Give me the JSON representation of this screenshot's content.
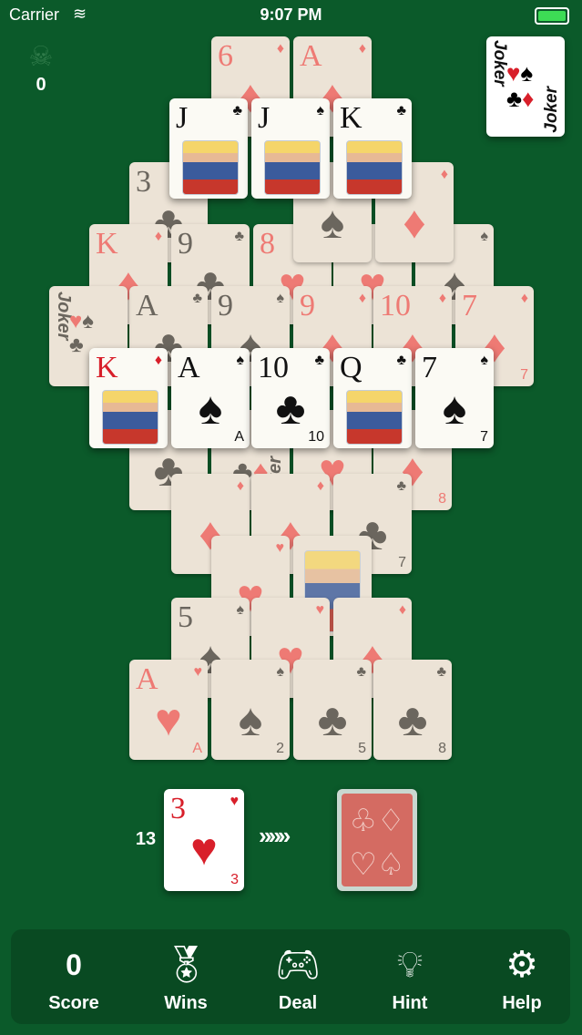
{
  "status_bar": {
    "carrier": "Carrier",
    "time": "9:07 PM"
  },
  "skull_counter": "0",
  "joker_card": {
    "text": "Joker"
  },
  "tableau": [
    {
      "id": "c1",
      "rank": "6",
      "suit": "♦",
      "color": "red",
      "dim": true,
      "pip": "6"
    },
    {
      "id": "c2",
      "rank": "A",
      "suit": "♦",
      "color": "red",
      "dim": true,
      "pip": "A"
    },
    {
      "id": "c3",
      "rank": "3",
      "suit": "♣",
      "color": "black",
      "dim": true,
      "pip": "3"
    },
    {
      "id": "c5",
      "rank": "K",
      "suit": "♦",
      "color": "red",
      "dim": true,
      "pip": "K"
    },
    {
      "id": "c6",
      "rank": "9",
      "suit": "♣",
      "color": "black",
      "dim": true,
      "pip": "9"
    },
    {
      "id": "c7",
      "rank": "8",
      "suit": "♥",
      "color": "red",
      "dim": true,
      "pip": "8"
    },
    {
      "id": "c8",
      "rank": "7",
      "suit": "♥",
      "color": "red",
      "dim": true,
      "pip": "7"
    },
    {
      "id": "c9",
      "rank": "6",
      "suit": "♠",
      "color": "black",
      "dim": true,
      "pip": "6"
    },
    {
      "id": "c10",
      "rank": "",
      "suit": "♠",
      "color": "black",
      "dim": true,
      "pip": ""
    },
    {
      "id": "c11",
      "rank": "",
      "suit": "♦",
      "color": "red",
      "dim": true,
      "pip": ""
    },
    {
      "id": "c13",
      "rank": "A",
      "suit": "♣",
      "color": "black",
      "dim": true,
      "pip": "A"
    },
    {
      "id": "c14",
      "rank": "9",
      "suit": "♠",
      "color": "black",
      "dim": true,
      "pip": "9"
    },
    {
      "id": "c15",
      "rank": "9",
      "suit": "♦",
      "color": "red",
      "dim": true,
      "pip": "9"
    },
    {
      "id": "c16",
      "rank": "10",
      "suit": "♦",
      "color": "red",
      "dim": true,
      "pip": "10"
    },
    {
      "id": "c17",
      "rank": "7",
      "suit": "♦",
      "color": "red",
      "dim": true,
      "pip": "7"
    },
    {
      "id": "c18",
      "rank": "",
      "suit": "♣",
      "color": "black",
      "dim": true,
      "pip": "6"
    },
    {
      "id": "c20",
      "rank": "",
      "suit": "♥",
      "color": "red",
      "dim": true,
      "pip": "9"
    },
    {
      "id": "c21",
      "rank": "",
      "suit": "♦",
      "color": "red",
      "dim": true,
      "pip": "8"
    },
    {
      "id": "c22",
      "rank": "",
      "suit": "♦",
      "color": "red",
      "dim": true,
      "pip": "4"
    },
    {
      "id": "c23",
      "rank": "",
      "suit": "♦",
      "color": "red",
      "dim": true,
      "pip": "3"
    },
    {
      "id": "c24",
      "rank": "",
      "suit": "♣",
      "color": "black",
      "dim": true,
      "pip": "7"
    },
    {
      "id": "c25",
      "rank": "",
      "suit": "♥",
      "color": "red",
      "dim": true,
      "pip": "5"
    },
    {
      "id": "c27",
      "rank": "5",
      "suit": "♠",
      "color": "black",
      "dim": true,
      "pip": "5"
    },
    {
      "id": "c28",
      "rank": "",
      "suit": "♥",
      "color": "red",
      "dim": true,
      "pip": "6"
    },
    {
      "id": "c29",
      "rank": "",
      "suit": "♦",
      "color": "red",
      "dim": true,
      "pip": "5"
    },
    {
      "id": "c30",
      "rank": "A",
      "suit": "♥",
      "color": "red",
      "dim": true,
      "pip": "A"
    },
    {
      "id": "c31",
      "rank": "",
      "suit": "♠",
      "color": "black",
      "dim": true,
      "pip": "2"
    },
    {
      "id": "c32",
      "rank": "",
      "suit": "♣",
      "color": "black",
      "dim": true,
      "pip": "5"
    },
    {
      "id": "c33",
      "rank": "",
      "suit": "♣",
      "color": "black",
      "dim": true,
      "pip": "8"
    },
    {
      "id": "c40",
      "rank": "J",
      "suit": "♣",
      "color": "black",
      "dim": false,
      "pip": "",
      "face": true
    },
    {
      "id": "c41",
      "rank": "J",
      "suit": "♠",
      "color": "black",
      "dim": false,
      "pip": "",
      "face": true
    },
    {
      "id": "c42",
      "rank": "K",
      "suit": "♣",
      "color": "black",
      "dim": false,
      "pip": "",
      "face": true
    },
    {
      "id": "c43",
      "rank": "K",
      "suit": "♦",
      "color": "red",
      "dim": false,
      "pip": "",
      "face": true
    },
    {
      "id": "c44",
      "rank": "A",
      "suit": "♠",
      "color": "black",
      "dim": false,
      "pip": "A"
    },
    {
      "id": "c45",
      "rank": "10",
      "suit": "♣",
      "color": "black",
      "dim": false,
      "pip": "10"
    },
    {
      "id": "c46",
      "rank": "Q",
      "suit": "♣",
      "color": "black",
      "dim": false,
      "pip": "",
      "face": true
    },
    {
      "id": "c47",
      "rank": "7",
      "suit": "♠",
      "color": "black",
      "dim": false,
      "pip": "7"
    }
  ],
  "stock": {
    "count": "13",
    "waste_rank": "3",
    "waste_suit": "♥",
    "waste_pip": "3",
    "arrows": "»»»"
  },
  "toolbar": {
    "score_value": "0",
    "score_label": "Score",
    "wins_label": "Wins",
    "deal_label": "Deal",
    "hint_label": "Hint",
    "help_label": "Help"
  },
  "colors": {
    "felt": "#0b5a2a",
    "toolbar": "#094a22",
    "red": "#d81f2a",
    "card_back": "#d46b62"
  }
}
